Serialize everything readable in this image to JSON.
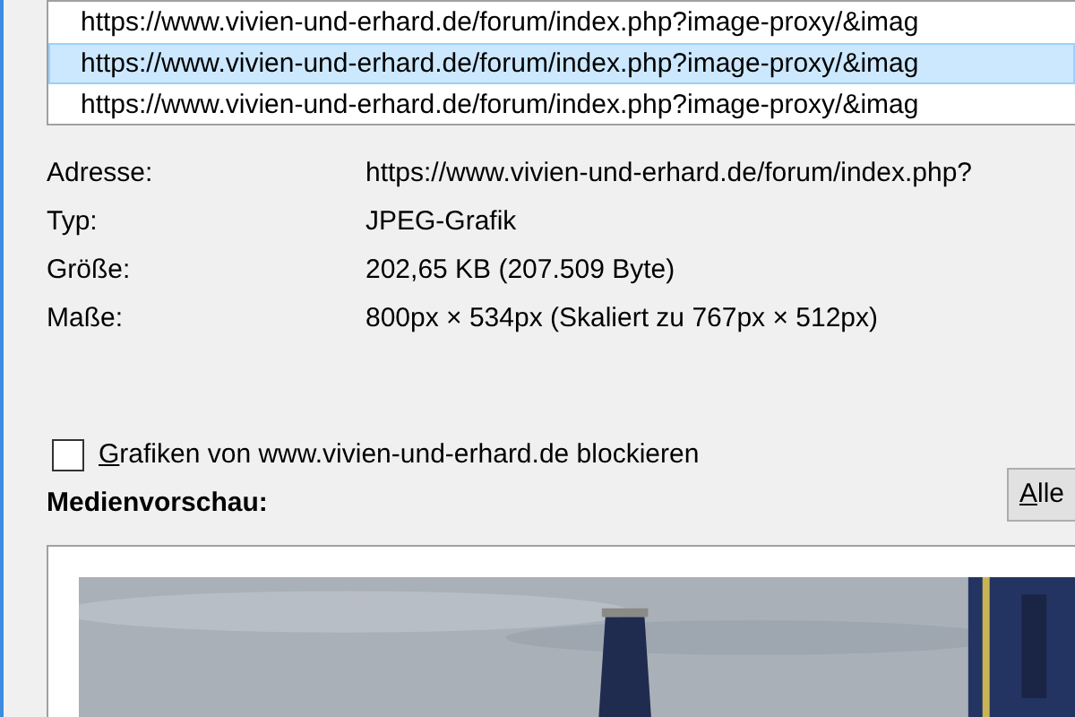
{
  "address_list": [
    {
      "text": "https://www.vivien-und-erhard.de/forum/index.php?image-proxy/&imag",
      "selected": false
    },
    {
      "text": "https://www.vivien-und-erhard.de/forum/index.php?image-proxy/&imag",
      "selected": true
    },
    {
      "text": "https://www.vivien-und-erhard.de/forum/index.php?image-proxy/&imag",
      "selected": false
    }
  ],
  "properties": [
    {
      "label": "Adresse:",
      "value": "https://www.vivien-und-erhard.de/forum/index.php?"
    },
    {
      "label": "Typ:",
      "value": "JPEG-Grafik"
    },
    {
      "label": "Größe:",
      "value": "202,65 KB (207.509 Byte)"
    },
    {
      "label": "Maße:",
      "value": "800px × 534px (Skaliert zu 767px × 512px)"
    }
  ],
  "block_checkbox": {
    "label": "Grafiken von www.vivien-und-erhard.de blockieren",
    "checked": false
  },
  "preview_heading": "Medienvorschau:",
  "save_button": "Alle"
}
